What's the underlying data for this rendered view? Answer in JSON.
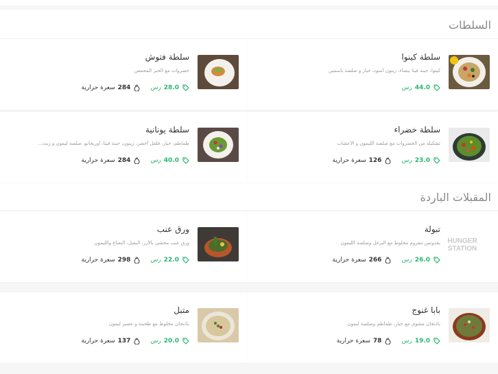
{
  "sections": [
    {
      "title": "السلطات",
      "items": [
        {
          "name": "سلطة كينوا",
          "desc": "كينوا، جبنة فيتا بيضاء، زيتون أسود، خيار و صلصة ياسمين",
          "price": "44.0",
          "currency": "رس",
          "calories": "",
          "calories_unit": ""
        },
        {
          "name": "سلطة فتوش",
          "desc": "خضروات مع الخبز المحمص",
          "price": "28.0",
          "currency": "رس",
          "calories": "284",
          "calories_unit": "سعرة حرارية"
        },
        {
          "name": "سلطة خضراء",
          "desc": "تشكيلة من الخضروات مع صلصة الليمون و الأعشاب",
          "price": "23.0",
          "currency": "رس",
          "calories": "126",
          "calories_unit": "سعرة حرارية"
        },
        {
          "name": "سلطة يونانية",
          "desc": "طماطم، خيار، فلفل أخضر، زيتون، جبنة فيتا، أوريجانو، صلصة ليمون و زيت...",
          "price": "40.0",
          "currency": "رس",
          "calories": "284",
          "calories_unit": "سعرة حرارية"
        }
      ]
    },
    {
      "title": "المقبلات الباردة",
      "items": [
        {
          "name": "تبولة",
          "desc": "بقدونس مفروم مخلوط مع البرغل وصلصة الليمون",
          "price": "26.0",
          "currency": "رس",
          "calories": "266",
          "calories_unit": "سعرة حرارية",
          "brand": "HUNGER STATION"
        },
        {
          "name": "ورق عنب",
          "desc": "ورق عنب محشي بالأرز، البصل، النعناع والليمون",
          "price": "22.0",
          "currency": "رس",
          "calories": "298",
          "calories_unit": "سعرة حرارية"
        },
        {
          "name": "بابا غنوج",
          "desc": "باذنجان مشوي مع خيار، طماطم وصلصة ليمون",
          "price": "19.0",
          "currency": "رس",
          "calories": "78",
          "calories_unit": "سعرة حرارية"
        },
        {
          "name": "متبل",
          "desc": "باذنجان مخلوط مع طحينة و عصير ليمون",
          "price": "20.0",
          "currency": "رس",
          "calories": "137",
          "calories_unit": "سعرة حرارية"
        }
      ]
    }
  ],
  "icons": {
    "price": "tag-icon",
    "calories": "flame-icon"
  },
  "colors": {
    "accent": "#2bb673",
    "background": "#f6f6f6",
    "card": "#ffffff",
    "muted": "#9a9a9a",
    "title": "#8a8a8a"
  }
}
